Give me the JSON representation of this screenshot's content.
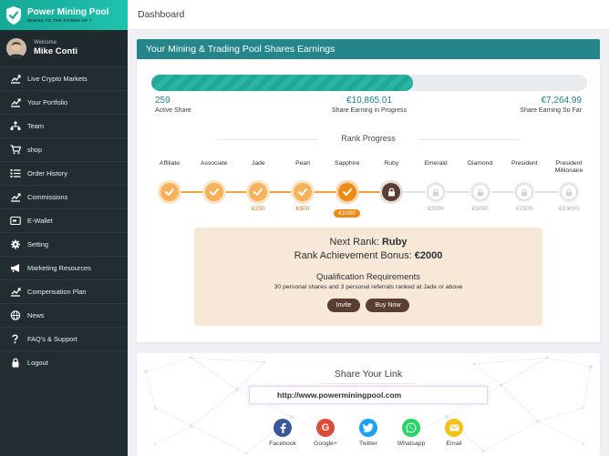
{
  "brand": {
    "title": "Power Mining Pool",
    "tagline": "MINING TO THE POWER OF 7"
  },
  "user": {
    "welcome": "Welcome",
    "name": "Mike Conti"
  },
  "sidebar": {
    "items": [
      {
        "label": "Live Crypto Markets",
        "icon": "chart-icon"
      },
      {
        "label": "Your Portfolio",
        "icon": "chart-icon"
      },
      {
        "label": "Team",
        "icon": "team-icon"
      },
      {
        "label": "shop",
        "icon": "cart-icon"
      },
      {
        "label": "Order History",
        "icon": "list-icon"
      },
      {
        "label": "Commissions",
        "icon": "chart-icon"
      },
      {
        "label": "E-Wallet",
        "icon": "wallet-icon"
      },
      {
        "label": "Setting",
        "icon": "gear-icon"
      },
      {
        "label": "Marketing Resources",
        "icon": "megaphone-icon"
      },
      {
        "label": "Compensation Plan",
        "icon": "chart-icon"
      },
      {
        "label": "News",
        "icon": "globe-icon"
      },
      {
        "label": "FAQ's & Support",
        "icon": "question-icon"
      },
      {
        "label": "Logout",
        "icon": "lock-icon"
      }
    ]
  },
  "topbar": {
    "title": "Dashboard"
  },
  "earnings": {
    "header": "Your Mining & Trading Pool Shares Earnings",
    "progress_fraction": 0.6,
    "active_share_value": "259",
    "active_share_label": "Active Share",
    "in_progress_value": "€10,865.01",
    "in_progress_label": "Share Earning in Progress",
    "so_far_value": "€7,264.99",
    "so_far_label": "Share Earning So Far"
  },
  "rank_progress": {
    "title": "Rank Progress",
    "ranks": [
      {
        "name": "Affiliate",
        "status": "done",
        "amount": ""
      },
      {
        "name": "Associate",
        "status": "done",
        "amount": ""
      },
      {
        "name": "Jade",
        "status": "done",
        "amount": "€250"
      },
      {
        "name": "Pearl",
        "status": "done",
        "amount": "€500"
      },
      {
        "name": "Sapphire",
        "status": "current",
        "amount": "€1000"
      },
      {
        "name": "Ruby",
        "status": "next",
        "amount": ""
      },
      {
        "name": "Emerald",
        "status": "locked",
        "amount": "€3500"
      },
      {
        "name": "Diamond",
        "status": "locked",
        "amount": "€5000"
      },
      {
        "name": "President",
        "status": "locked",
        "amount": "€7500"
      },
      {
        "name": "President Millionaire",
        "status": "locked",
        "amount": "€10000"
      }
    ]
  },
  "next_rank": {
    "next_label": "Next Rank:",
    "next_value": "Ruby",
    "bonus_label": "Rank Achievement Bonus:",
    "bonus_value": "€2000",
    "qual_title": "Qualification Requirements",
    "qual_desc": "30 personal shares and 3 personal referrals ranked at Jade or above",
    "invite_label": "Invite",
    "buy_label": "Buy Now"
  },
  "share": {
    "title": "Share Your Link",
    "link": "http://www.powerminingpool.com",
    "socials": [
      {
        "label": "Facebook",
        "icon": "facebook-icon",
        "color": "#3b5998"
      },
      {
        "label": "Google+",
        "icon": "google-plus-icon",
        "color": "#dd4b39"
      },
      {
        "label": "Twitter",
        "icon": "twitter-icon",
        "color": "#1da1f2"
      },
      {
        "label": "Whatsapp",
        "icon": "whatsapp-icon",
        "color": "#25d366"
      },
      {
        "label": "Email",
        "icon": "email-icon",
        "color": "#f2c218"
      }
    ]
  }
}
